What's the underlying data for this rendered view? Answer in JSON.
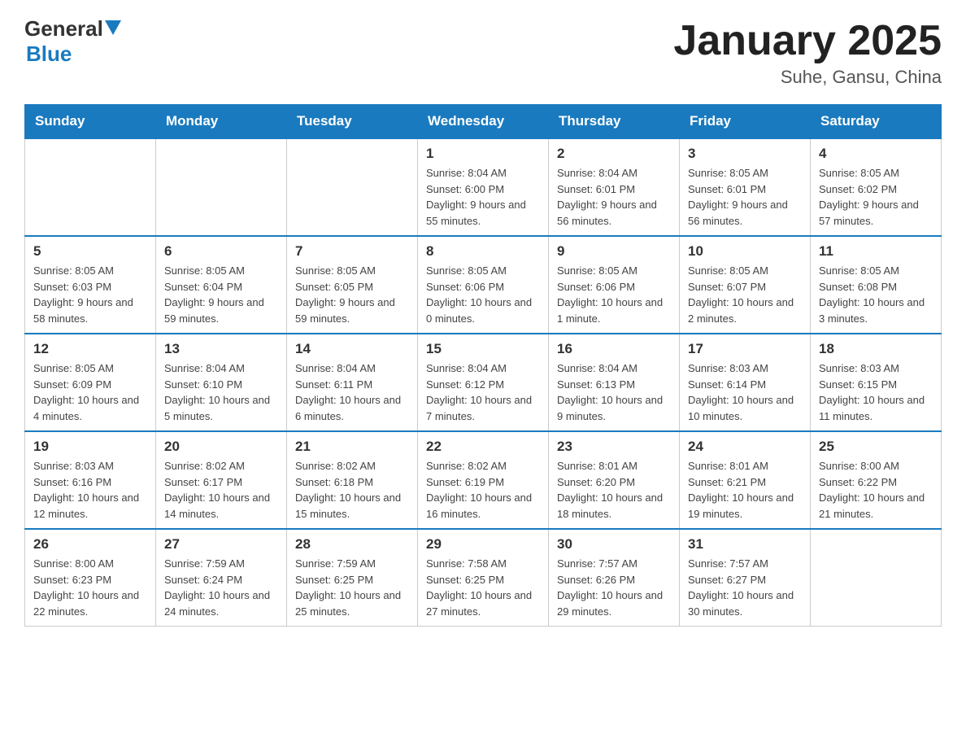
{
  "header": {
    "logo_general": "General",
    "logo_blue": "Blue",
    "title": "January 2025",
    "subtitle": "Suhe, Gansu, China"
  },
  "calendar": {
    "weekdays": [
      "Sunday",
      "Monday",
      "Tuesday",
      "Wednesday",
      "Thursday",
      "Friday",
      "Saturday"
    ],
    "weeks": [
      {
        "days": [
          {
            "num": "",
            "sunrise": "",
            "sunset": "",
            "daylight": ""
          },
          {
            "num": "",
            "sunrise": "",
            "sunset": "",
            "daylight": ""
          },
          {
            "num": "",
            "sunrise": "",
            "sunset": "",
            "daylight": ""
          },
          {
            "num": "1",
            "sunrise": "Sunrise: 8:04 AM",
            "sunset": "Sunset: 6:00 PM",
            "daylight": "Daylight: 9 hours and 55 minutes."
          },
          {
            "num": "2",
            "sunrise": "Sunrise: 8:04 AM",
            "sunset": "Sunset: 6:01 PM",
            "daylight": "Daylight: 9 hours and 56 minutes."
          },
          {
            "num": "3",
            "sunrise": "Sunrise: 8:05 AM",
            "sunset": "Sunset: 6:01 PM",
            "daylight": "Daylight: 9 hours and 56 minutes."
          },
          {
            "num": "4",
            "sunrise": "Sunrise: 8:05 AM",
            "sunset": "Sunset: 6:02 PM",
            "daylight": "Daylight: 9 hours and 57 minutes."
          }
        ]
      },
      {
        "days": [
          {
            "num": "5",
            "sunrise": "Sunrise: 8:05 AM",
            "sunset": "Sunset: 6:03 PM",
            "daylight": "Daylight: 9 hours and 58 minutes."
          },
          {
            "num": "6",
            "sunrise": "Sunrise: 8:05 AM",
            "sunset": "Sunset: 6:04 PM",
            "daylight": "Daylight: 9 hours and 59 minutes."
          },
          {
            "num": "7",
            "sunrise": "Sunrise: 8:05 AM",
            "sunset": "Sunset: 6:05 PM",
            "daylight": "Daylight: 9 hours and 59 minutes."
          },
          {
            "num": "8",
            "sunrise": "Sunrise: 8:05 AM",
            "sunset": "Sunset: 6:06 PM",
            "daylight": "Daylight: 10 hours and 0 minutes."
          },
          {
            "num": "9",
            "sunrise": "Sunrise: 8:05 AM",
            "sunset": "Sunset: 6:06 PM",
            "daylight": "Daylight: 10 hours and 1 minute."
          },
          {
            "num": "10",
            "sunrise": "Sunrise: 8:05 AM",
            "sunset": "Sunset: 6:07 PM",
            "daylight": "Daylight: 10 hours and 2 minutes."
          },
          {
            "num": "11",
            "sunrise": "Sunrise: 8:05 AM",
            "sunset": "Sunset: 6:08 PM",
            "daylight": "Daylight: 10 hours and 3 minutes."
          }
        ]
      },
      {
        "days": [
          {
            "num": "12",
            "sunrise": "Sunrise: 8:05 AM",
            "sunset": "Sunset: 6:09 PM",
            "daylight": "Daylight: 10 hours and 4 minutes."
          },
          {
            "num": "13",
            "sunrise": "Sunrise: 8:04 AM",
            "sunset": "Sunset: 6:10 PM",
            "daylight": "Daylight: 10 hours and 5 minutes."
          },
          {
            "num": "14",
            "sunrise": "Sunrise: 8:04 AM",
            "sunset": "Sunset: 6:11 PM",
            "daylight": "Daylight: 10 hours and 6 minutes."
          },
          {
            "num": "15",
            "sunrise": "Sunrise: 8:04 AM",
            "sunset": "Sunset: 6:12 PM",
            "daylight": "Daylight: 10 hours and 7 minutes."
          },
          {
            "num": "16",
            "sunrise": "Sunrise: 8:04 AM",
            "sunset": "Sunset: 6:13 PM",
            "daylight": "Daylight: 10 hours and 9 minutes."
          },
          {
            "num": "17",
            "sunrise": "Sunrise: 8:03 AM",
            "sunset": "Sunset: 6:14 PM",
            "daylight": "Daylight: 10 hours and 10 minutes."
          },
          {
            "num": "18",
            "sunrise": "Sunrise: 8:03 AM",
            "sunset": "Sunset: 6:15 PM",
            "daylight": "Daylight: 10 hours and 11 minutes."
          }
        ]
      },
      {
        "days": [
          {
            "num": "19",
            "sunrise": "Sunrise: 8:03 AM",
            "sunset": "Sunset: 6:16 PM",
            "daylight": "Daylight: 10 hours and 12 minutes."
          },
          {
            "num": "20",
            "sunrise": "Sunrise: 8:02 AM",
            "sunset": "Sunset: 6:17 PM",
            "daylight": "Daylight: 10 hours and 14 minutes."
          },
          {
            "num": "21",
            "sunrise": "Sunrise: 8:02 AM",
            "sunset": "Sunset: 6:18 PM",
            "daylight": "Daylight: 10 hours and 15 minutes."
          },
          {
            "num": "22",
            "sunrise": "Sunrise: 8:02 AM",
            "sunset": "Sunset: 6:19 PM",
            "daylight": "Daylight: 10 hours and 16 minutes."
          },
          {
            "num": "23",
            "sunrise": "Sunrise: 8:01 AM",
            "sunset": "Sunset: 6:20 PM",
            "daylight": "Daylight: 10 hours and 18 minutes."
          },
          {
            "num": "24",
            "sunrise": "Sunrise: 8:01 AM",
            "sunset": "Sunset: 6:21 PM",
            "daylight": "Daylight: 10 hours and 19 minutes."
          },
          {
            "num": "25",
            "sunrise": "Sunrise: 8:00 AM",
            "sunset": "Sunset: 6:22 PM",
            "daylight": "Daylight: 10 hours and 21 minutes."
          }
        ]
      },
      {
        "days": [
          {
            "num": "26",
            "sunrise": "Sunrise: 8:00 AM",
            "sunset": "Sunset: 6:23 PM",
            "daylight": "Daylight: 10 hours and 22 minutes."
          },
          {
            "num": "27",
            "sunrise": "Sunrise: 7:59 AM",
            "sunset": "Sunset: 6:24 PM",
            "daylight": "Daylight: 10 hours and 24 minutes."
          },
          {
            "num": "28",
            "sunrise": "Sunrise: 7:59 AM",
            "sunset": "Sunset: 6:25 PM",
            "daylight": "Daylight: 10 hours and 25 minutes."
          },
          {
            "num": "29",
            "sunrise": "Sunrise: 7:58 AM",
            "sunset": "Sunset: 6:25 PM",
            "daylight": "Daylight: 10 hours and 27 minutes."
          },
          {
            "num": "30",
            "sunrise": "Sunrise: 7:57 AM",
            "sunset": "Sunset: 6:26 PM",
            "daylight": "Daylight: 10 hours and 29 minutes."
          },
          {
            "num": "31",
            "sunrise": "Sunrise: 7:57 AM",
            "sunset": "Sunset: 6:27 PM",
            "daylight": "Daylight: 10 hours and 30 minutes."
          },
          {
            "num": "",
            "sunrise": "",
            "sunset": "",
            "daylight": ""
          }
        ]
      }
    ]
  }
}
